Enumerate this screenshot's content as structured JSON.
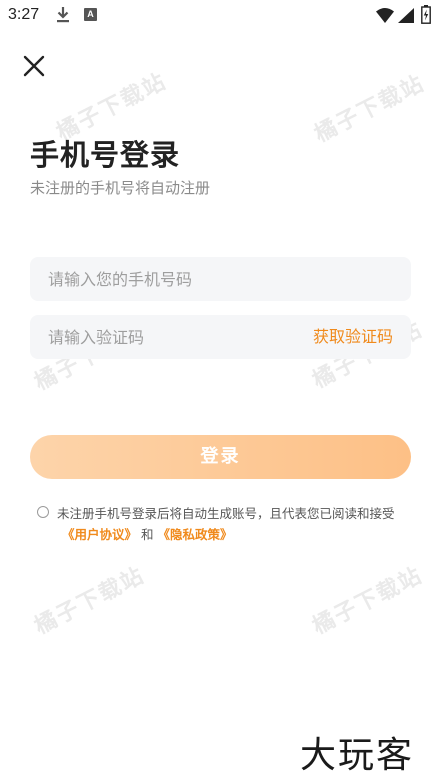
{
  "status_bar": {
    "time": "3:27",
    "notification_letter": "A"
  },
  "login": {
    "title": "手机号登录",
    "subtitle": "未注册的手机号将自动注册",
    "phone_placeholder": "请输入您的手机号码",
    "code_placeholder": "请输入验证码",
    "get_code_label": "获取验证码",
    "login_button_label": "登录",
    "agreement_text": "未注册手机号登录后将自动生成账号，且代表您已阅读和接受",
    "user_agreement_link": "《用户协议》",
    "and_text": "和",
    "privacy_policy_link": "《隐私政策》"
  },
  "watermark_text": "橘子下载站",
  "brand_logo_text": "大玩客",
  "colors": {
    "accent": "#f08a1c",
    "button_gradient_start": "#fdd4aa",
    "button_gradient_end": "#fdc086",
    "input_bg": "#f5f6f8"
  },
  "icons": {
    "close": "close-icon",
    "download": "download-icon",
    "wifi": "wifi-icon",
    "signal": "signal-icon",
    "battery": "battery-icon"
  }
}
